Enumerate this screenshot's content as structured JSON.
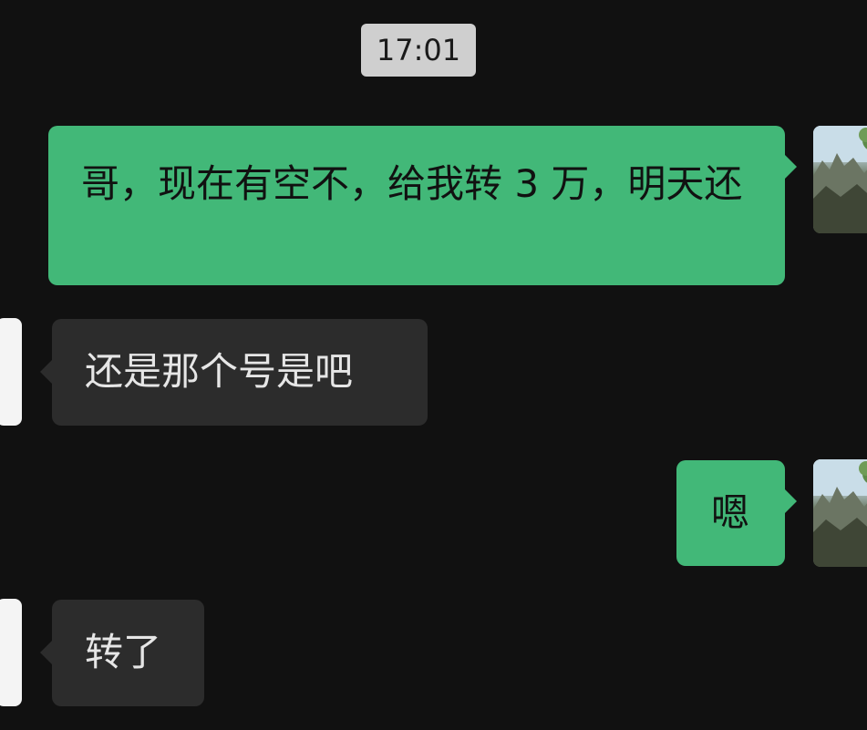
{
  "timestamp": "17:01",
  "messages": [
    {
      "side": "outgoing",
      "text": "哥，现在有空不，给我转 3 万，明天还"
    },
    {
      "side": "incoming",
      "text": "还是那个号是吧"
    },
    {
      "side": "outgoing",
      "text": "嗯"
    },
    {
      "side": "incoming",
      "text": "转了"
    }
  ],
  "colors": {
    "background": "#111111",
    "outgoing_bubble": "#42b878",
    "incoming_bubble": "#2c2c2c",
    "timestamp_bg": "#cfcfcf"
  },
  "icons": {
    "self_avatar": "landscape-photo-avatar",
    "contact_avatar": "white-avatar"
  }
}
